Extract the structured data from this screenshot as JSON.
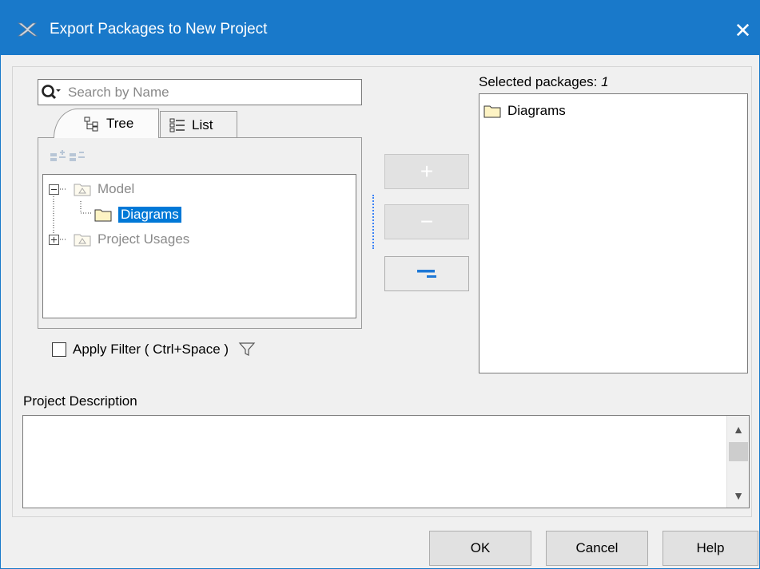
{
  "window": {
    "title": "Export Packages to New Project",
    "close_glyph": "✕",
    "app_icon": "magicdraw-x-icon"
  },
  "search": {
    "placeholder": "Search by Name",
    "icon": "search-icon"
  },
  "tabs": [
    {
      "label": "Tree",
      "icon": "tree-icon",
      "active": true
    },
    {
      "label": "List",
      "icon": "list-icon",
      "active": false
    }
  ],
  "tree": {
    "items": [
      {
        "label": "Model",
        "expanded": true,
        "level": 0,
        "selected": false
      },
      {
        "label": "Diagrams",
        "level": 1,
        "selected": true
      },
      {
        "label": "Project Usages",
        "expanded": false,
        "level": 0,
        "selected": false
      }
    ]
  },
  "move_buttons": {
    "add": "+",
    "remove": "−",
    "remove_all": "remove-all-icon"
  },
  "filter": {
    "label": "Apply Filter ( Ctrl+Space )",
    "checked": false,
    "icon": "funnel-icon"
  },
  "selected_packages": {
    "label": "Selected packages: ",
    "count": "1",
    "items": [
      {
        "label": "Diagrams"
      }
    ]
  },
  "description": {
    "label": "Project Description",
    "value": ""
  },
  "buttons": {
    "ok": "OK",
    "cancel": "Cancel",
    "help": "Help"
  },
  "colors": {
    "title_bar": "#1979ca",
    "selection": "#0078d7",
    "folder_fill": "#fdf3c4"
  }
}
